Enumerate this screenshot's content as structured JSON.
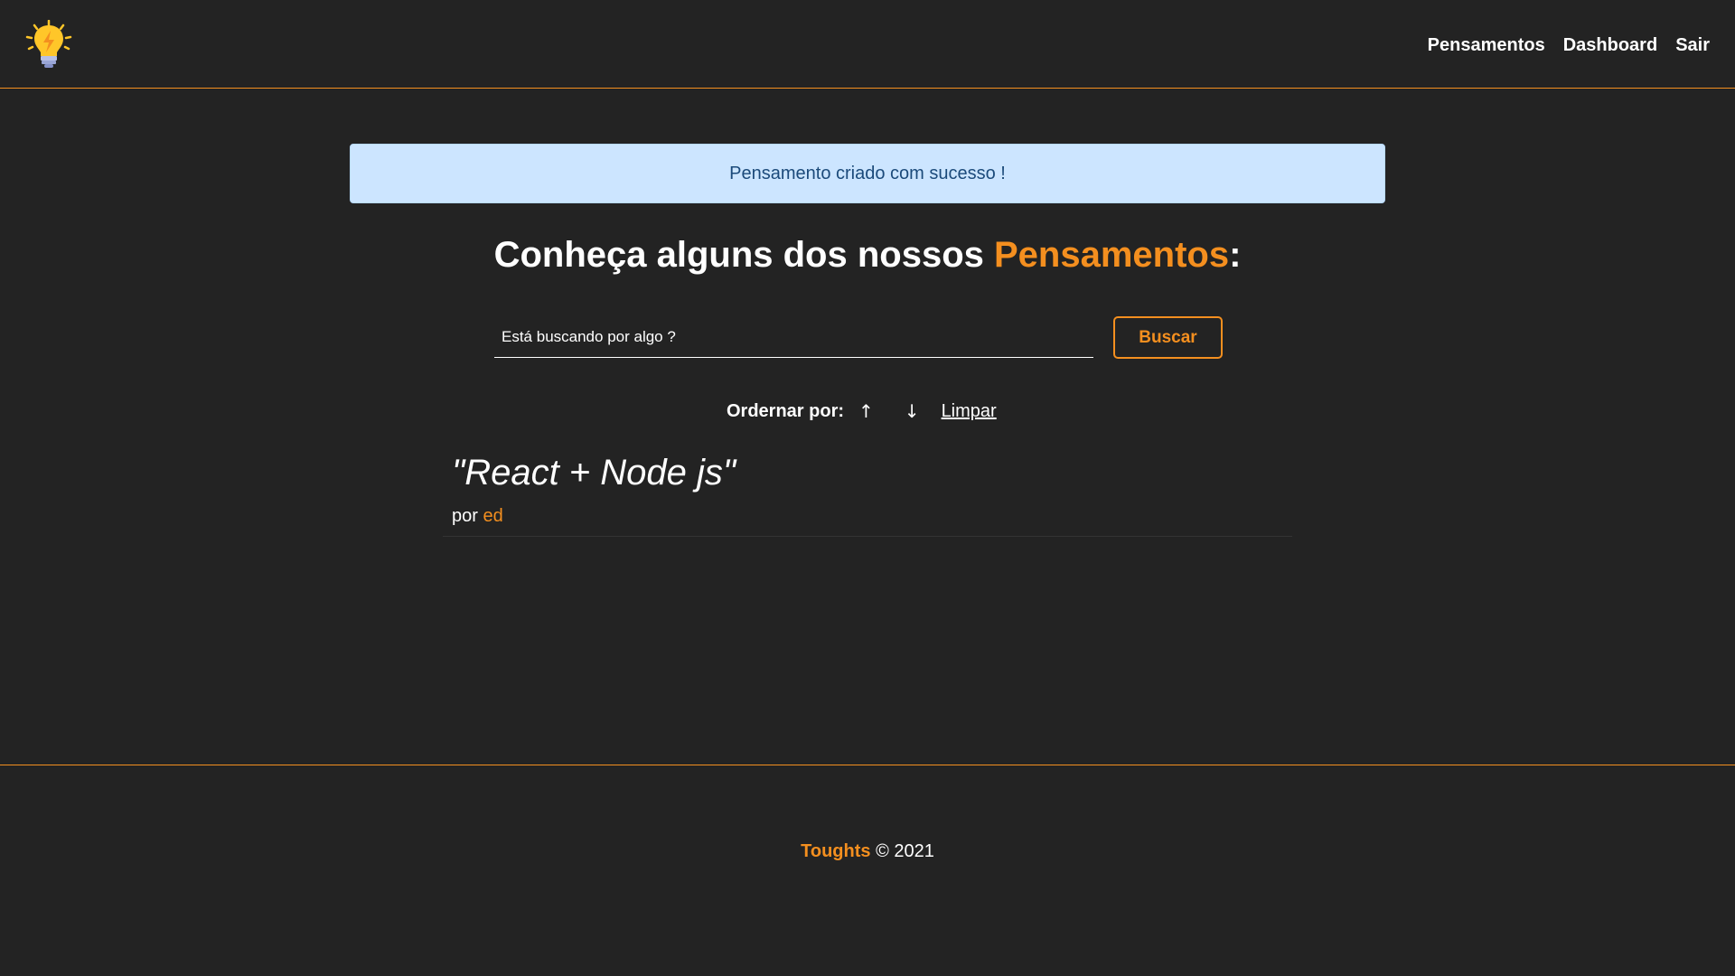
{
  "navbar": {
    "logo": {
      "icon": "lightbulb-icon",
      "colors": {
        "bulb": "#ffc629",
        "base": "#9aa6d6",
        "bolt": "#f48f1f"
      }
    },
    "links": [
      {
        "label": "Pensamentos"
      },
      {
        "label": "Dashboard"
      },
      {
        "label": "Sair"
      }
    ]
  },
  "flash": {
    "message": "Pensamento criado com sucesso !"
  },
  "heading": {
    "prefix": "Conheça alguns dos nossos ",
    "highlight": "Pensamentos",
    "suffix": ":"
  },
  "search": {
    "placeholder": "Está buscando por algo ?",
    "value": "",
    "button_label": "Buscar"
  },
  "order": {
    "label": "Ordernar por:",
    "asc_icon": "↑",
    "desc_icon": "↓",
    "clear_label": "Limpar"
  },
  "thoughts": [
    {
      "title": "\"React + Node js\"",
      "author_prefix": "por ",
      "author": "ed"
    }
  ],
  "footer": {
    "brand": "Toughts",
    "copyright": " © 2021"
  },
  "colors": {
    "background": "#232323",
    "accent": "#f48f1f",
    "flash_bg": "#cce5ff",
    "flash_text": "#1b4a7a"
  }
}
